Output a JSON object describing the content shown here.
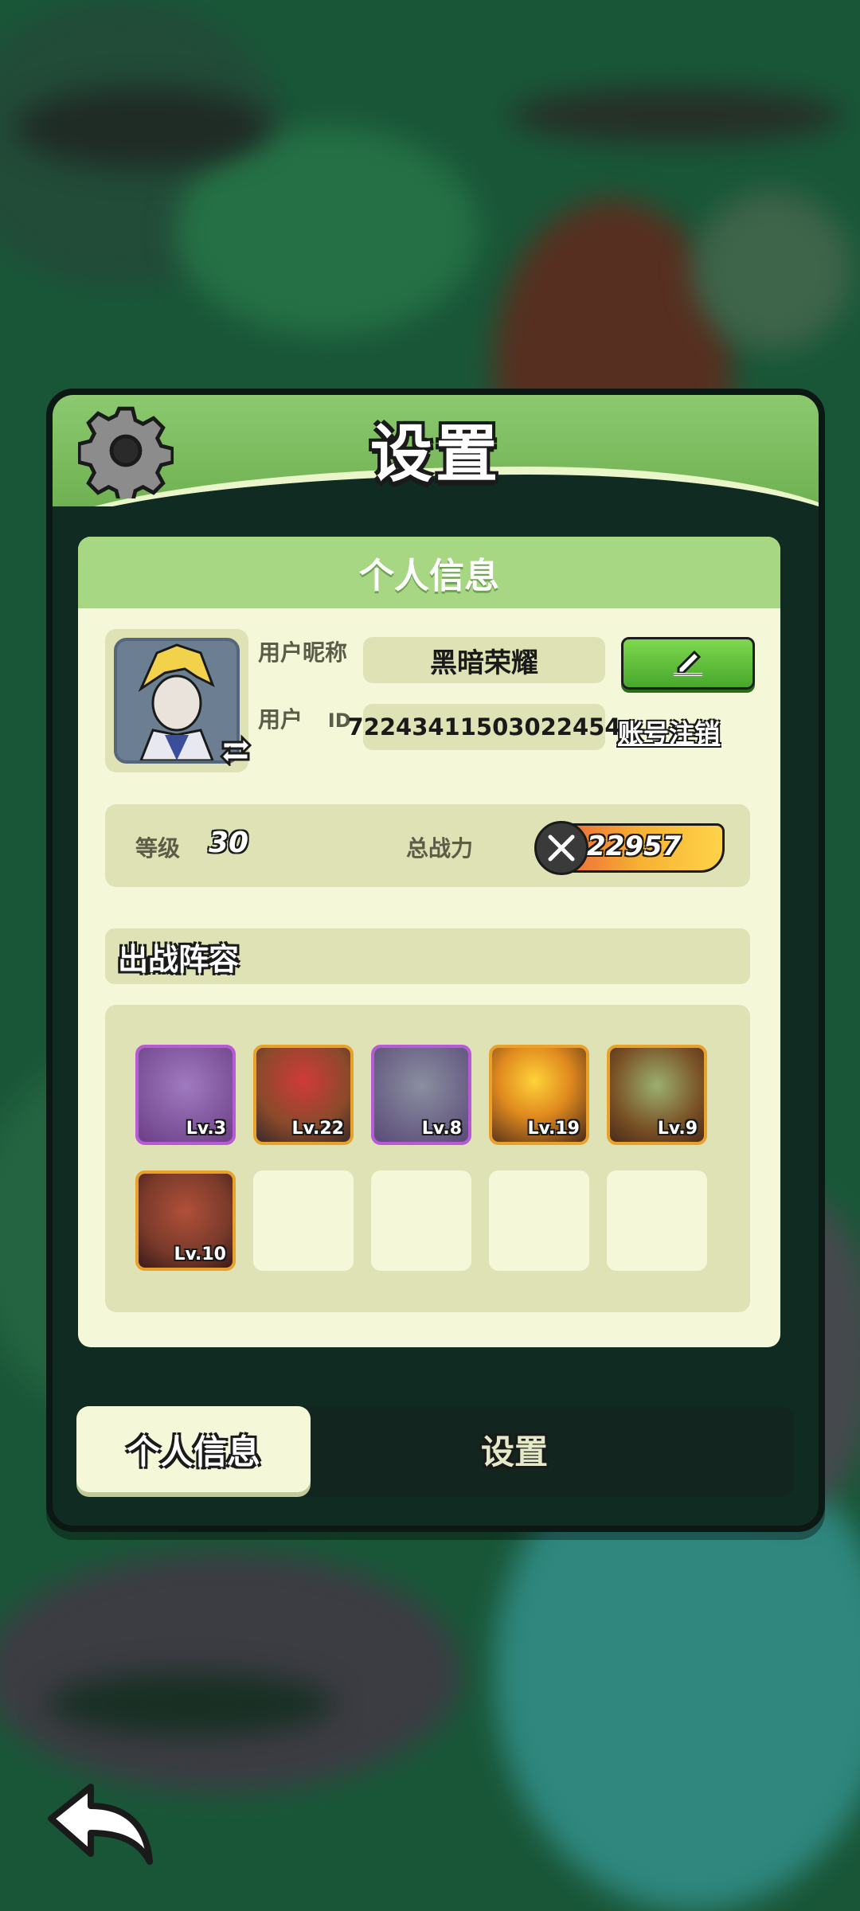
{
  "panel": {
    "title": "设置"
  },
  "profile": {
    "section_title": "个人信息",
    "nickname_label": "用户昵称",
    "nickname": "黑暗荣耀",
    "id_label": "用户",
    "id_tag": "ID",
    "user_id": "72243411503022454",
    "cancel_account": "账号注销",
    "level_label": "等级",
    "level": "30",
    "power_label": "总战力",
    "power": "22957"
  },
  "lineup": {
    "title": "出战阵容",
    "heroes": [
      {
        "level": "Lv.3",
        "frame": "purple",
        "color": "#6b3f86"
      },
      {
        "level": "Lv.22",
        "frame": "orange",
        "color": "#8a4a2a"
      },
      {
        "level": "Lv.8",
        "frame": "purple",
        "color": "#5a4a78"
      },
      {
        "level": "Lv.19",
        "frame": "orange",
        "color": "#7a4a1e"
      },
      {
        "level": "Lv.9",
        "frame": "orange",
        "color": "#7a5226"
      },
      {
        "level": "Lv.10",
        "frame": "orange",
        "color": "#7a3a2a"
      }
    ],
    "empty_slots": 4
  },
  "tabs": {
    "active": "个人信息",
    "inactive": "设置"
  },
  "colors": {
    "header_green": "#8cc96f",
    "card_bg": "#f4f8d8",
    "field_bg": "#dfe2b4",
    "edit_button": "#5bbf37"
  },
  "icons": {
    "gear": "gear-icon",
    "edit": "pencil-icon",
    "swap": "swap-arrows-icon",
    "power": "crossed-swords-icon",
    "back": "back-arrow-icon"
  }
}
